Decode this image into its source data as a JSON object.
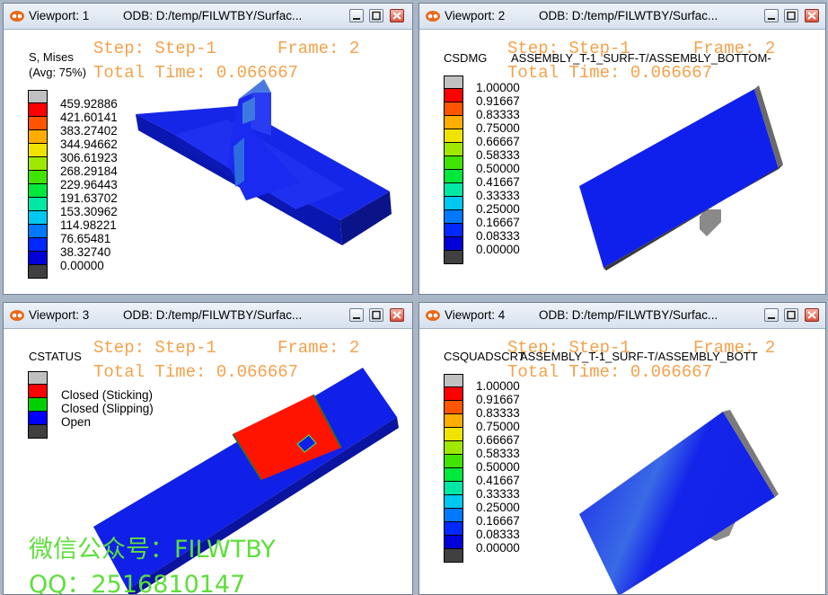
{
  "viewports": [
    {
      "title": "Viewport: 1",
      "odb": "ODB: D:/temp/FILWTBY/Surfac...",
      "step": "Step: Step-1",
      "frame": "Frame: 2",
      "time": "Total Time: 0.066667",
      "field": "S, Mises",
      "avg": "(Avg: 75%)",
      "scale": [
        "459.92886",
        "421.60141",
        "383.27402",
        "344.94662",
        "306.61923",
        "268.29184",
        "229.96443",
        "191.63702",
        "153.30962",
        "114.98221",
        "76.65481",
        "38.32740",
        "0.00000"
      ]
    },
    {
      "title": "Viewport: 2",
      "odb": "ODB: D:/temp/FILWTBY/Surfac...",
      "step": "Step: Step-1",
      "frame": "Frame: 2",
      "time": "Total Time: 0.066667",
      "field": "CSDMG",
      "surface": "ASSEMBLY_T-1_SURF-T/ASSEMBLY_BOTTOM-",
      "scale": [
        "1.00000",
        "0.91667",
        "0.83333",
        "0.75000",
        "0.66667",
        "0.58333",
        "0.50000",
        "0.41667",
        "0.33333",
        "0.25000",
        "0.16667",
        "0.08333",
        "0.00000"
      ]
    },
    {
      "title": "Viewport: 3",
      "odb": "ODB: D:/temp/FILWTBY/Surfac...",
      "step": "Step: Step-1",
      "frame": "Frame: 2",
      "time": "Total Time: 0.066667",
      "field": "CSTATUS",
      "legend": [
        "Closed (Sticking)",
        "Closed (Slipping)",
        "Open"
      ]
    },
    {
      "title": "Viewport: 4",
      "odb": "ODB: D:/temp/FILWTBY/Surfac...",
      "step": "Step: Step-1",
      "frame": "Frame: 2",
      "time": "Total Time: 0.066667",
      "field": "CSQUADSCRT",
      "surface": "ASSEMBLY_T-1_SURF-T/ASSEMBLY_BOTT",
      "scale": [
        "1.00000",
        "0.91667",
        "0.83333",
        "0.75000",
        "0.66667",
        "0.58333",
        "0.50000",
        "0.41667",
        "0.33333",
        "0.25000",
        "0.16667",
        "0.08333",
        "0.00000"
      ]
    }
  ],
  "scale_colors": [
    "#c0c0c0",
    "#ff0000",
    "#ff5400",
    "#ffad00",
    "#f0e300",
    "#9fe800",
    "#40e400",
    "#00e83c",
    "#00e8a4",
    "#00c8f0",
    "#0078ff",
    "#0028ff",
    "#0000d8",
    "#404040"
  ],
  "status_colors": [
    "#c0c0c0",
    "#ff0000",
    "#00d000",
    "#0000ff",
    "#404040"
  ],
  "watermark": {
    "line1": "微信公众号：FILWTBY",
    "line2": "QQ：2516810147",
    "color": "#5ddf3a"
  }
}
